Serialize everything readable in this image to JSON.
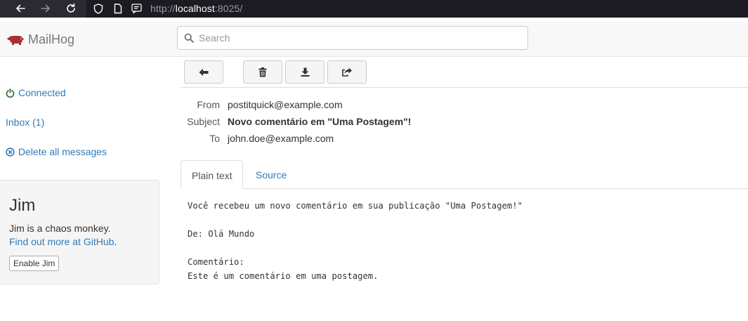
{
  "browser": {
    "url_base": "http://",
    "url_host": "localhost",
    "url_port": ":8025/"
  },
  "header": {
    "brand": "MailHog",
    "search_placeholder": "Search"
  },
  "sidebar": {
    "connected": "Connected",
    "inbox": "Inbox (1)",
    "delete_all": "Delete all messages",
    "jim": {
      "title": "Jim",
      "description": "Jim is a chaos monkey.",
      "link_text": "Find out more at GitHub",
      "link_suffix": ".",
      "button": "Enable Jim"
    }
  },
  "toolbar": {
    "icons": [
      "arrow-left-icon",
      "trash-icon",
      "download-icon",
      "share-icon"
    ]
  },
  "message": {
    "from_label": "From",
    "from_value": "postitquick@example.com",
    "subject_label": "Subject",
    "subject_value": "Novo comentário em \"Uma Postagem\"!",
    "to_label": "To",
    "to_value": "john.doe@example.com",
    "tabs": [
      "Plain text",
      "Source"
    ],
    "body": "Você recebeu um novo comentário em sua publicação \"Uma Postagem!\"\n\nDe: Olá Mundo\n\nComentário:\nEste é um comentário em uma postagem."
  },
  "colors": {
    "link": "#337ab7",
    "connected": "#3c763d",
    "brand_icon": "#a83232"
  }
}
